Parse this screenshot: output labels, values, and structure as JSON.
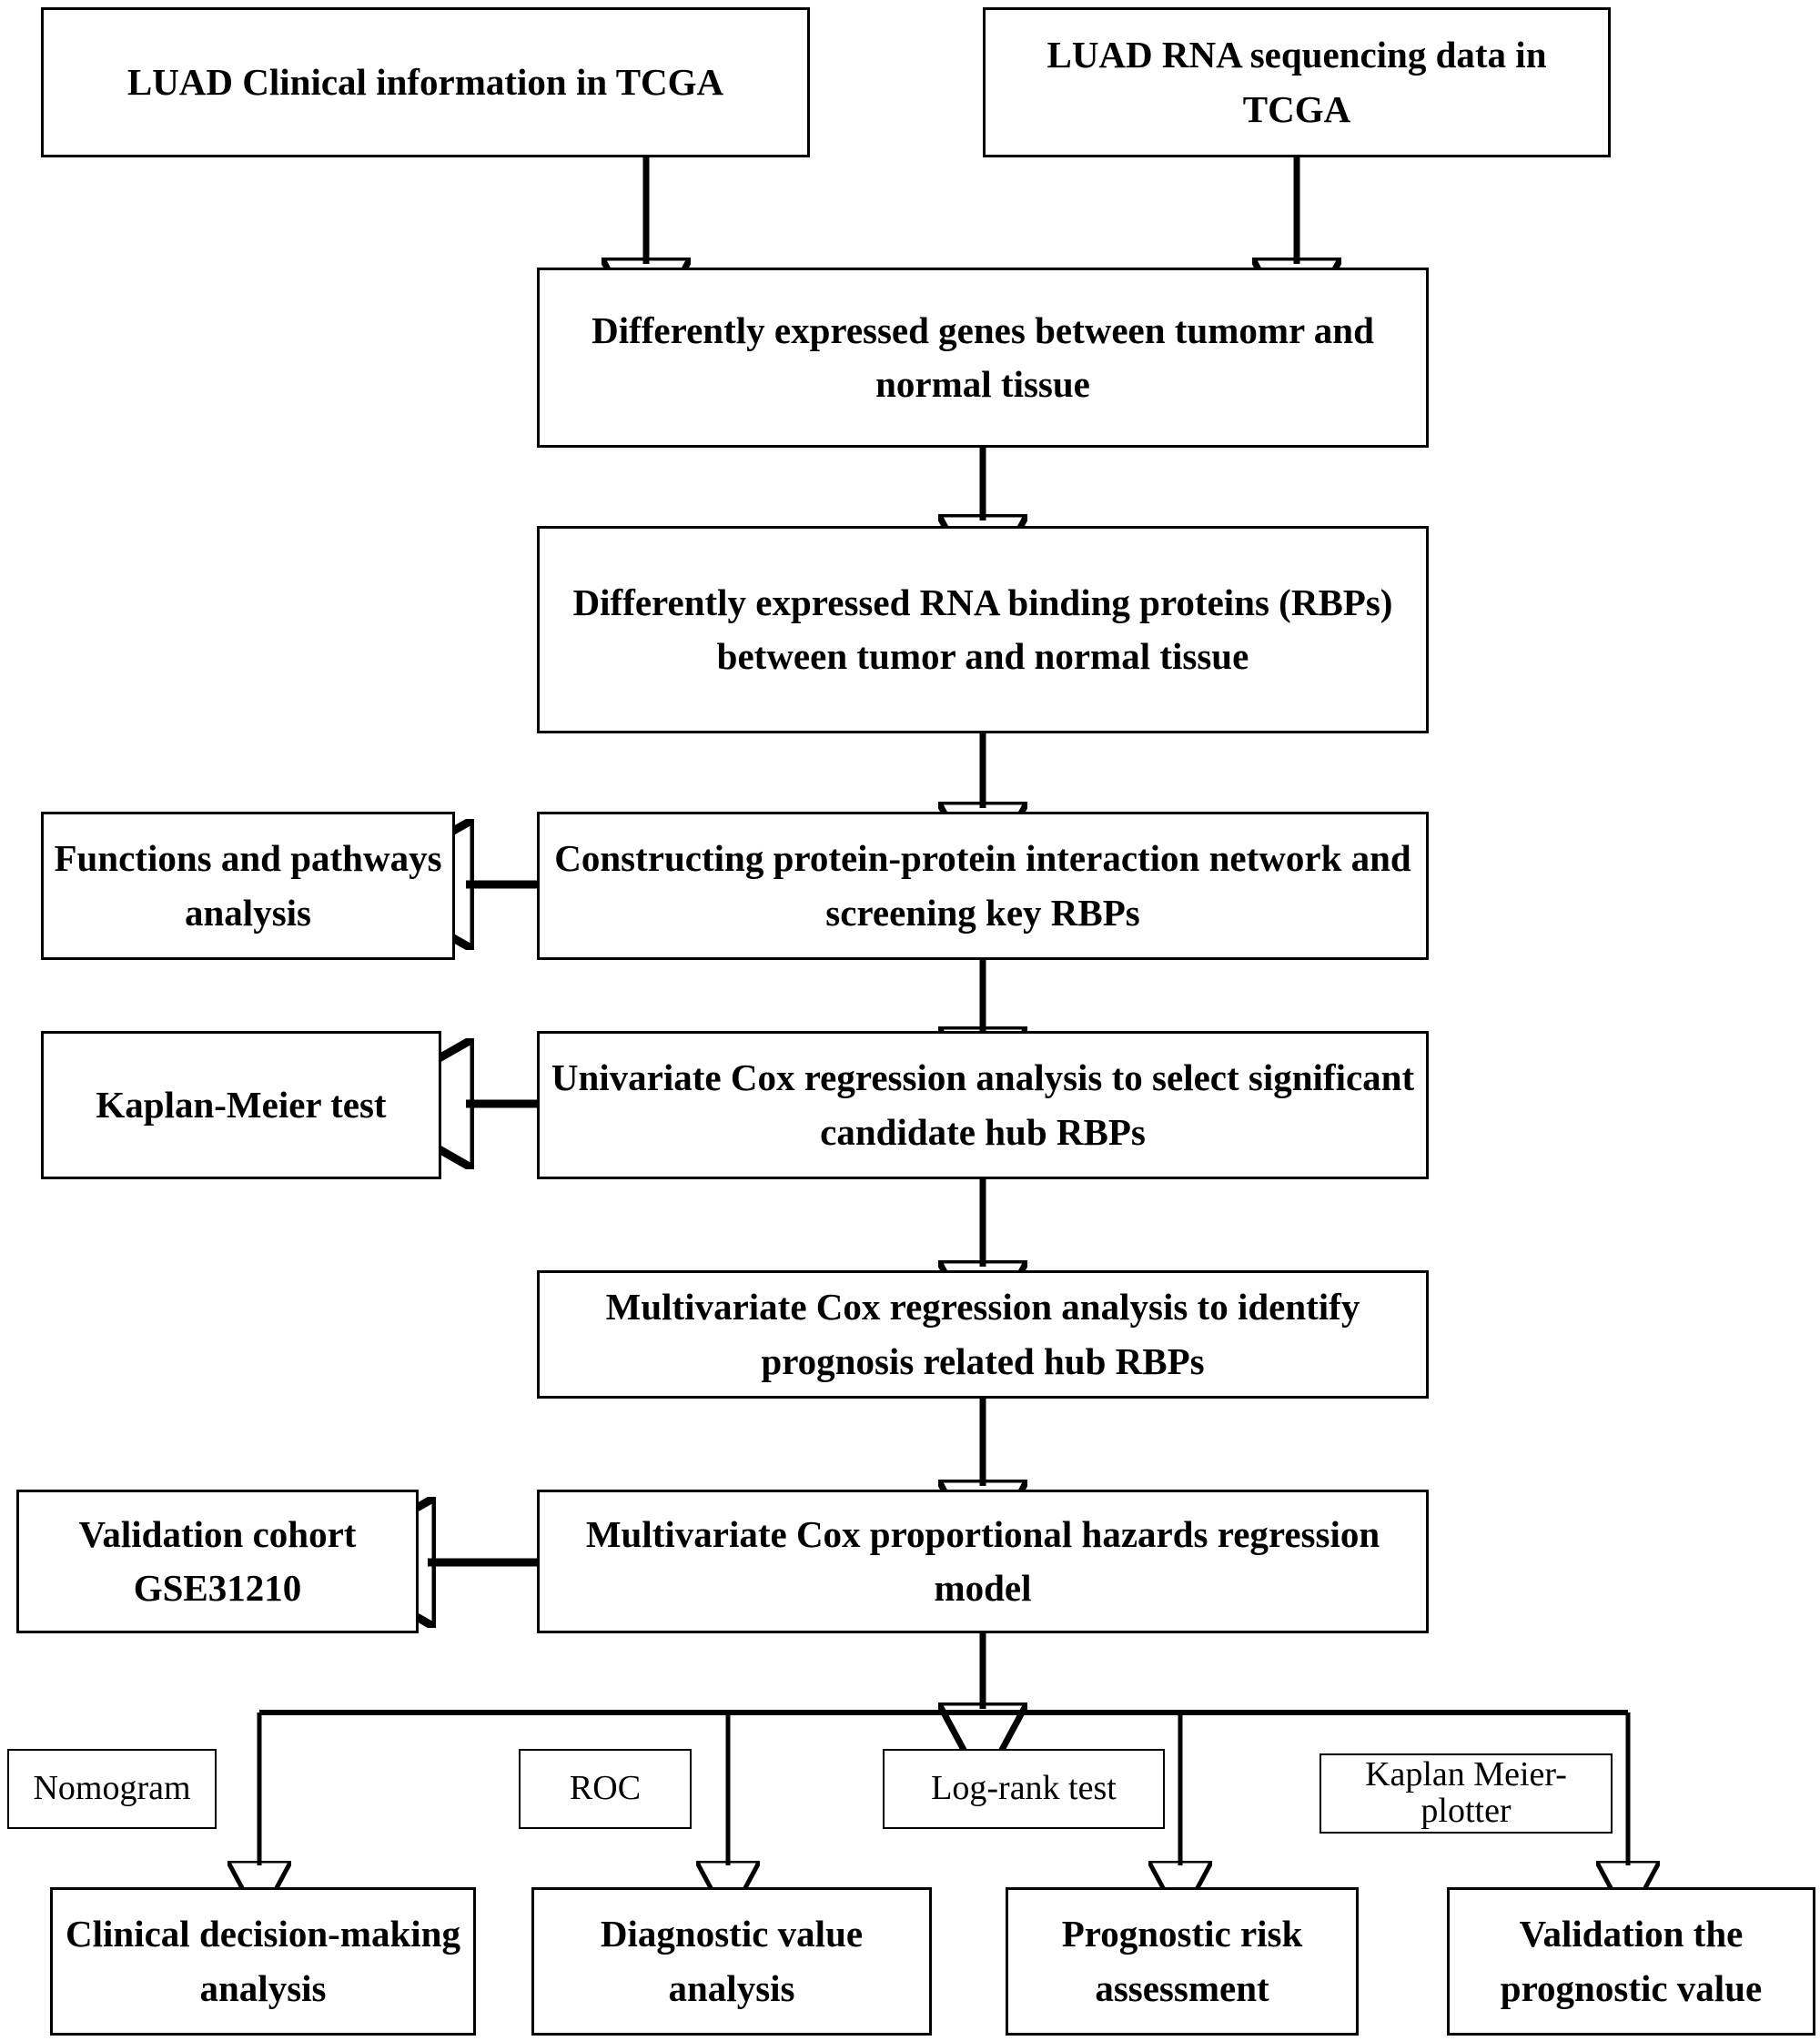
{
  "diagram": {
    "title": "LUAD RBP prognostic signature analysis workflow",
    "type": "flowchart",
    "line_color": "#000000",
    "background": "#ffffff",
    "nodes": {
      "clinical_info": "LUAD Clinical information in TCGA",
      "rna_seq": "LUAD RNA sequencing data in TCGA",
      "deg": "Differently expressed genes between tumomr and normal tissue",
      "derbp": "Differently expressed RNA binding proteins (RBPs) between tumor and normal tissue",
      "ppi": "Constructing protein-protein interaction network and screening key RBPs",
      "functions": "Functions and pathways analysis",
      "univariate": "Univariate Cox regression analysis to select significant candidate hub RBPs",
      "km_test": "Kaplan-Meier test",
      "multivariate": "Multivariate Cox regression analysis to identify prognosis related hub RBPs",
      "cox_model": "Multivariate Cox proportional hazards regression model",
      "validation_cohort": "Validation cohort GSE31210",
      "nomogram": "Nomogram",
      "roc": "ROC",
      "logrank": "Log-rank test",
      "km_plotter": "Kaplan Meier-plotter",
      "clinical_decision": "Clinical decision-making analysis",
      "diagnostic_value": "Diagnostic value analysis",
      "prognostic_risk": "Prognostic risk assessment",
      "validation_prognostic": "Validation the prognostic value"
    },
    "edges": [
      {
        "from": "clinical_info",
        "to": "deg",
        "style": "arrow-down"
      },
      {
        "from": "rna_seq",
        "to": "deg",
        "style": "arrow-down"
      },
      {
        "from": "deg",
        "to": "derbp",
        "style": "arrow-down"
      },
      {
        "from": "derbp",
        "to": "ppi",
        "style": "arrow-down"
      },
      {
        "from": "ppi",
        "to": "functions",
        "style": "arrow-left"
      },
      {
        "from": "ppi",
        "to": "univariate",
        "style": "arrow-down"
      },
      {
        "from": "univariate",
        "to": "km_test",
        "style": "arrow-left"
      },
      {
        "from": "univariate",
        "to": "multivariate",
        "style": "arrow-down"
      },
      {
        "from": "multivariate",
        "to": "cox_model",
        "style": "arrow-down"
      },
      {
        "from": "cox_model",
        "to": "validation_cohort",
        "style": "arrow-left"
      },
      {
        "from": "cox_model",
        "to": "clinical_decision",
        "style": "bus-down"
      },
      {
        "from": "cox_model",
        "to": "diagnostic_value",
        "style": "bus-down"
      },
      {
        "from": "cox_model",
        "to": "prognostic_risk",
        "style": "bus-down"
      },
      {
        "from": "cox_model",
        "to": "validation_prognostic",
        "style": "bus-down"
      }
    ]
  }
}
